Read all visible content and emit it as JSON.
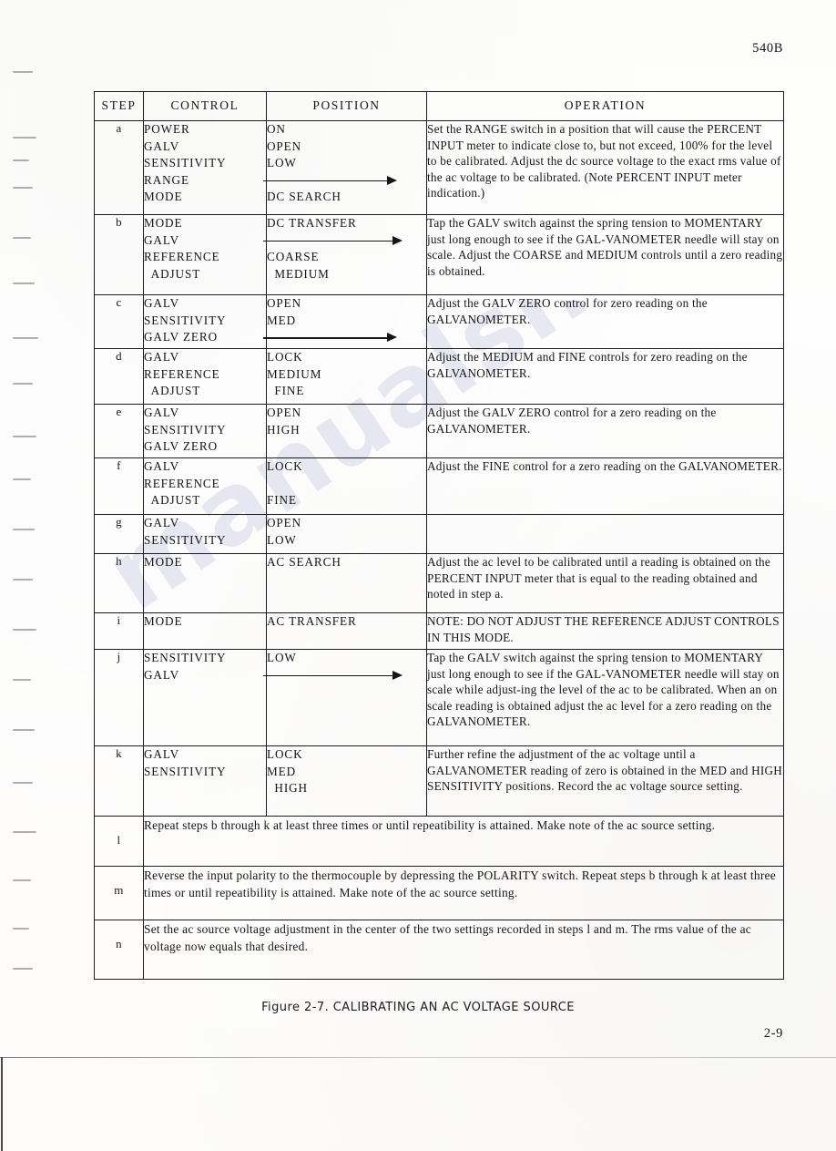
{
  "header": {
    "model_number": "540B"
  },
  "footer": {
    "page_number": "2-9",
    "caption": "Figure 2-7.  CALIBRATING AN AC VOLTAGE SOURCE"
  },
  "watermark": {
    "text": "manualshive.com"
  },
  "table": {
    "columns": [
      "STEP",
      "CONTROL",
      "POSITION",
      "OPERATION"
    ],
    "rows": [
      {
        "step": "a",
        "control": [
          "POWER",
          "GALV",
          "SENSITIVITY",
          "RANGE",
          "MODE"
        ],
        "position": [
          "ON",
          "OPEN",
          "LOW",
          "ARROW",
          "DC SEARCH"
        ],
        "operation": "Set the RANGE switch in a position that will cause the PERCENT INPUT meter to indicate close to, but not exceed, 100% for the level to be calibrated. Adjust the dc source voltage to the exact rms value of the ac voltage to be calibrated.  (Note PERCENT INPUT meter indication.)"
      },
      {
        "step": "b",
        "control": [
          "MODE",
          "GALV",
          "REFERENCE",
          "  ADJUST"
        ],
        "position": [
          "DC TRANSFER",
          "ARROW",
          "COARSE",
          "  MEDIUM"
        ],
        "operation": "Tap the GALV switch against the spring tension to MOMENTARY just long enough to see if the GAL-VANOMETER needle will stay on scale.  Adjust the COARSE and MEDIUM controls until a zero reading is obtained."
      },
      {
        "step": "c",
        "control": [
          "GALV",
          "SENSITIVITY",
          "GALV ZERO"
        ],
        "position": [
          "OPEN",
          "MED",
          "ARROW"
        ],
        "operation": "Adjust the GALV ZERO control for zero reading on the GALVANOMETER."
      },
      {
        "step": "d",
        "control": [
          "GALV",
          "REFERENCE",
          "  ADJUST"
        ],
        "position": [
          "LOCK",
          "MEDIUM",
          "  FINE"
        ],
        "operation": "Adjust the MEDIUM and FINE controls for zero reading on the GALVANOMETER."
      },
      {
        "step": "e",
        "control": [
          "GALV",
          "SENSITIVITY",
          "GALV ZERO"
        ],
        "position": [
          "OPEN",
          "HIGH"
        ],
        "operation": "Adjust the GALV ZERO control for a zero reading on the GALVANOMETER."
      },
      {
        "step": "f",
        "control": [
          "GALV",
          "REFERENCE",
          "  ADJUST"
        ],
        "position": [
          "LOCK",
          "",
          "FINE"
        ],
        "operation": "Adjust the FINE control for a zero reading on the GALVANOMETER."
      },
      {
        "step": "g",
        "control": [
          "GALV",
          "SENSITIVITY"
        ],
        "position": [
          "OPEN",
          "LOW"
        ],
        "operation": ""
      },
      {
        "step": "h",
        "control": [
          "MODE"
        ],
        "position": [
          "AC SEARCH"
        ],
        "operation": "Adjust the ac level to be calibrated until a reading is obtained on the PERCENT INPUT meter that is equal to the reading obtained and noted in step a."
      },
      {
        "step": "i",
        "control": [
          "MODE"
        ],
        "position": [
          "AC TRANSFER"
        ],
        "operation": "NOTE:  DO NOT ADJUST THE REFERENCE ADJUST CONTROLS IN THIS MODE."
      },
      {
        "step": "j",
        "control": [
          "SENSITIVITY",
          "GALV"
        ],
        "position": [
          "LOW",
          "ARROW"
        ],
        "operation": "Tap the GALV switch against the spring tension to MOMENTARY just long enough to see if the GAL-VANOMETER needle will stay on scale while adjust-ing the level of the ac to be calibrated.  When an on scale reading is obtained adjust the ac level for a zero reading on the GALVANOMETER."
      },
      {
        "step": "k",
        "control": [
          "GALV",
          "SENSITIVITY"
        ],
        "position": [
          "LOCK",
          "MED",
          "  HIGH"
        ],
        "operation": "Further refine the adjustment of the ac voltage until a GALVANOMETER reading of zero is obtained in the MED and HIGH SENSITIVITY positions.  Record the ac voltage source setting."
      }
    ],
    "full_width_rows": [
      {
        "step": "l",
        "text": "Repeat steps b through k at least three times or until repeatibility is attained.  Make note of the ac source setting."
      },
      {
        "step": "m",
        "text": "Reverse the  input polarity to the thermocouple by depressing the POLARITY switch.  Repeat steps b through k at least three times or until repeatibility is attained.  Make note of the ac source setting."
      },
      {
        "step": "n",
        "text": "Set the ac source voltage adjustment in the center of the two settings recorded in steps l and m. The rms value of the ac voltage now equals that desired."
      }
    ]
  }
}
